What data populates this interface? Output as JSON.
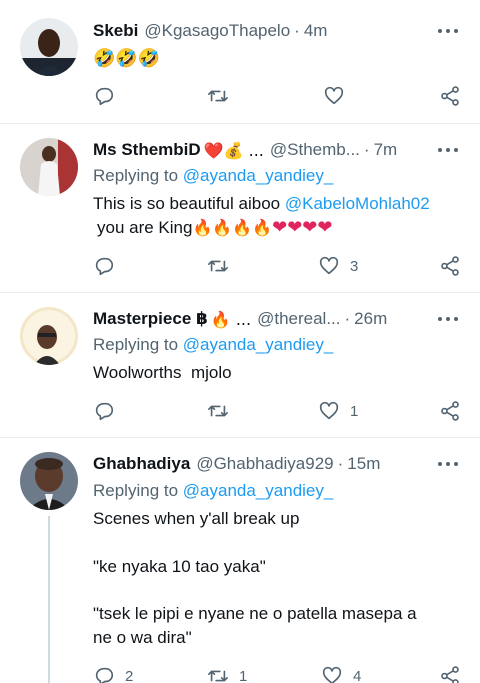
{
  "tweets": [
    {
      "name": "Skebi",
      "handle": "@KgasagoThapelo",
      "time": "4m",
      "text": "🤣🤣🤣",
      "counts": {
        "reply": "",
        "retweet": "",
        "like": ""
      }
    },
    {
      "name": "Ms SthembiD",
      "name_emoji": "❤️💰 ...",
      "handle": "@Sthemb...",
      "time": "7m",
      "replying_label": "Replying to",
      "replying_to": "@ayanda_yandiey_",
      "text_line1": "This is so beautiful aiboo",
      "text_mention": "@KabeloMohlah02",
      "text_line2": "you are King",
      "text_fire": "🔥🔥🔥🔥",
      "text_hearts": "❤❤❤❤",
      "counts": {
        "reply": "",
        "retweet": "",
        "like": "3"
      }
    },
    {
      "name": "Masterpiece ฿",
      "name_emoji": "🔥 ...",
      "handle": "@thereal...",
      "time": "26m",
      "replying_label": "Replying to",
      "replying_to": "@ayanda_yandiey_",
      "text": "Woolworths  mjolo",
      "counts": {
        "reply": "",
        "retweet": "",
        "like": "1"
      }
    },
    {
      "name": "Ghabhadiya",
      "handle": "@Ghabhadiya929",
      "time": "15m",
      "replying_label": "Replying to",
      "replying_to": "@ayanda_yandiey_",
      "text_lines": [
        "Scenes when y'all break up",
        "\"ke nyaka 10 tao yaka\"",
        "\"tsek le pipi e nyane ne o patella masepa a",
        "ne o wa dira\""
      ],
      "counts": {
        "reply": "2",
        "retweet": "1",
        "like": "4"
      }
    }
  ],
  "icons": {
    "reply": "reply-icon",
    "retweet": "retweet-icon",
    "like": "like-icon",
    "share": "share-icon",
    "more": "more-icon"
  },
  "colors": {
    "link": "#1d9bf0",
    "muted": "#536471",
    "divider": "#e6ecf0"
  }
}
